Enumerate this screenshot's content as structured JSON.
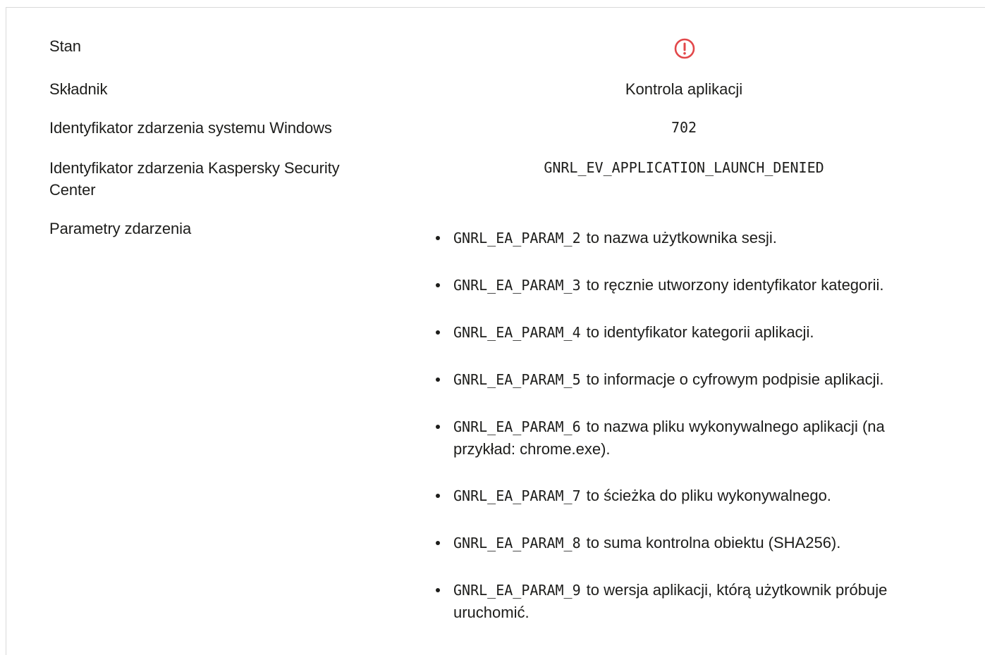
{
  "rows": {
    "status": {
      "label": "Stan",
      "icon": "alert-circle-icon",
      "icon_color": "#e2474a"
    },
    "component": {
      "label": "Składnik",
      "value": "Kontrola aplikacji"
    },
    "windows_event_id": {
      "label": "Identyfikator zdarzenia systemu Windows",
      "value": "702"
    },
    "ksc_event_id": {
      "label": "Identyfikator zdarzenia Kaspersky Security Center",
      "value": "GNRL_EV_APPLICATION_LAUNCH_DENIED"
    },
    "event_params": {
      "label": "Parametry zdarzenia"
    }
  },
  "params": [
    {
      "code": "GNRL_EA_PARAM_2",
      "text": "to nazwa użytkownika sesji."
    },
    {
      "code": "GNRL_EA_PARAM_3",
      "text": "to ręcznie utworzony identyfikator kategorii."
    },
    {
      "code": "GNRL_EA_PARAM_4",
      "text": "to identyfikator kategorii aplikacji."
    },
    {
      "code": "GNRL_EA_PARAM_5",
      "text": "to informacje o cyfrowym podpisie aplikacji."
    },
    {
      "code": "GNRL_EA_PARAM_6",
      "text": "to nazwa pliku wykonywalnego aplikacji (na przykład: chrome.exe)."
    },
    {
      "code": "GNRL_EA_PARAM_7",
      "text": "to ścieżka do pliku wykonywalnego."
    },
    {
      "code": "GNRL_EA_PARAM_8",
      "text": "to suma kontrolna obiektu (SHA256)."
    },
    {
      "code": "GNRL_EA_PARAM_9",
      "text": "to wersja aplikacji, którą użytkownik próbuje uruchomić."
    }
  ]
}
